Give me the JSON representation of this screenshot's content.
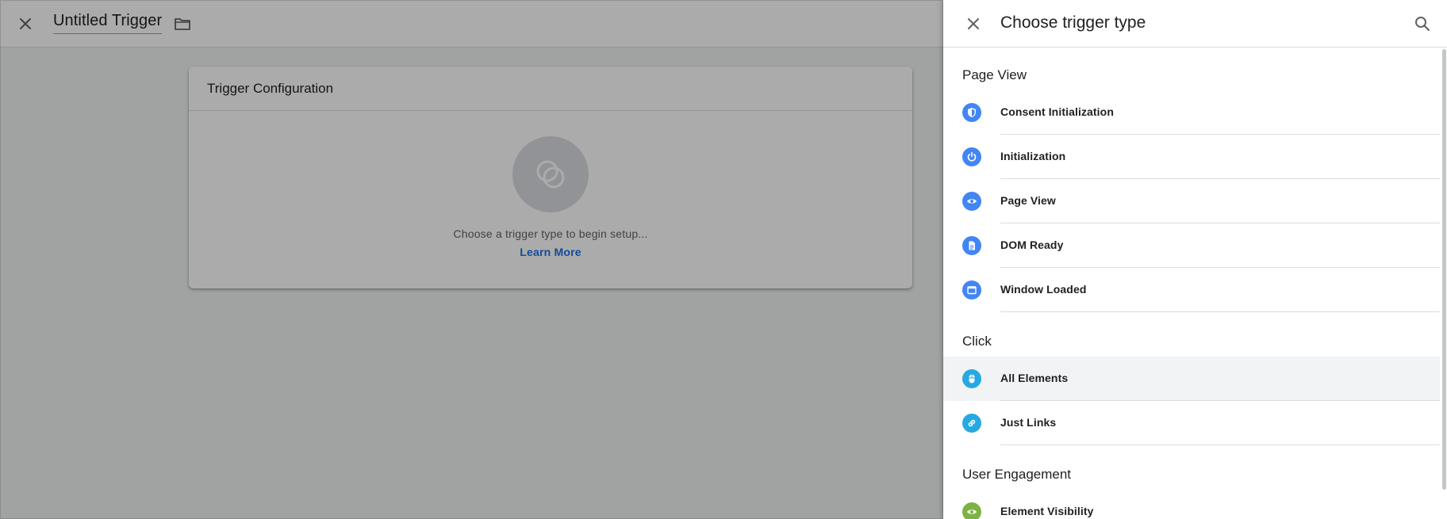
{
  "editor": {
    "title": "Untitled Trigger",
    "close_icon": "close-icon",
    "folder_icon": "folder-icon",
    "card": {
      "header": "Trigger Configuration",
      "hint": "Choose a trigger type to begin setup...",
      "learn_more": "Learn More",
      "placeholder_icon": "trigger-placeholder-icon"
    }
  },
  "panel": {
    "title": "Choose trigger type",
    "close_icon": "close-icon",
    "search_icon": "search-icon",
    "sections": [
      {
        "title": "Page View",
        "items": [
          {
            "label": "Consent Initialization",
            "icon": "shield-icon",
            "color": "#4285f4"
          },
          {
            "label": "Initialization",
            "icon": "power-icon",
            "color": "#4285f4"
          },
          {
            "label": "Page View",
            "icon": "eye-icon",
            "color": "#4285f4"
          },
          {
            "label": "DOM Ready",
            "icon": "document-icon",
            "color": "#4285f4"
          },
          {
            "label": "Window Loaded",
            "icon": "window-icon",
            "color": "#4285f4"
          }
        ]
      },
      {
        "title": "Click",
        "items": [
          {
            "label": "All Elements",
            "icon": "mouse-icon",
            "color": "#26a9e0"
          },
          {
            "label": "Just Links",
            "icon": "link-icon",
            "color": "#26a9e0"
          }
        ]
      },
      {
        "title": "User Engagement",
        "items": [
          {
            "label": "Element Visibility",
            "icon": "eye-icon",
            "color": "#7cb342"
          }
        ]
      }
    ]
  },
  "colors": {
    "accent_blue": "#1a73e8",
    "page_view_icon": "#4285f4",
    "click_icon": "#26a9e0",
    "engagement_icon": "#7cb342",
    "hover_row": "#f1f3f4"
  }
}
